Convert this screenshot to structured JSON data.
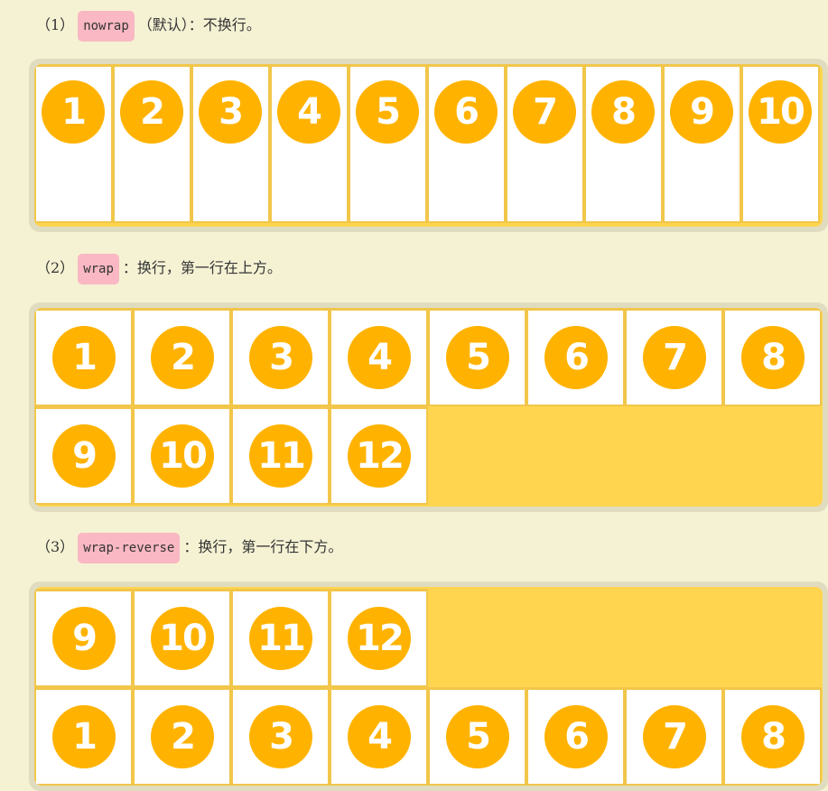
{
  "sections": [
    {
      "prefix": "（1）",
      "code": "nowrap",
      "suffix": "（默认）：不换行。",
      "items": [
        "1",
        "2",
        "3",
        "4",
        "5",
        "6",
        "7",
        "8",
        "9",
        "10"
      ]
    },
    {
      "prefix": "（2）",
      "code": "wrap",
      "suffix": "：换行，第一行在上方。",
      "items": [
        "1",
        "2",
        "3",
        "4",
        "5",
        "6",
        "7",
        "8",
        "9",
        "10",
        "11",
        "12"
      ]
    },
    {
      "prefix": "（3）",
      "code": "wrap-reverse",
      "suffix": "：换行，第一行在下方。",
      "items": [
        "1",
        "2",
        "3",
        "4",
        "5",
        "6",
        "7",
        "8",
        "9",
        "10",
        "11",
        "12"
      ]
    }
  ],
  "colors": {
    "page_background": "#f5f2d4",
    "container_frame": "#e0dcc0",
    "flex_container": "#ffd54f",
    "item_background": "#ffffff",
    "item_border": "#f1c64a",
    "circle": "#ffb300",
    "code_badge": "#f9b8c3"
  }
}
